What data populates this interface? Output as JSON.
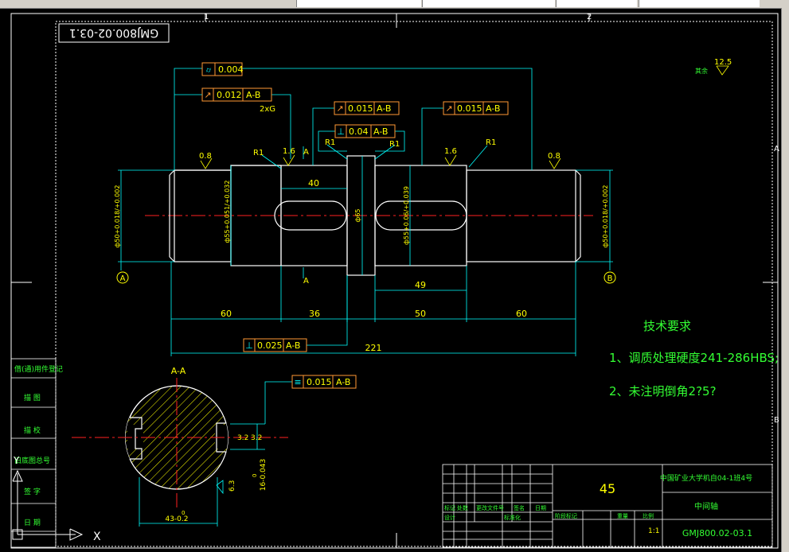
{
  "colors": {
    "background": "#000000",
    "outline": "#ffffff",
    "dimension": "#00ffff",
    "tolerance_frame": "#ff9933",
    "centerline": "#ff2020",
    "text": "#ffff00",
    "green_text": "#33ff33"
  },
  "drawing_number_rotated": "GMJ800.02-03.1",
  "grid_labels": {
    "top1": "1",
    "top2": "2",
    "right1": "A",
    "right2": "B"
  },
  "tolerances": {
    "cylindricity": {
      "symbol": "⌭",
      "value": "0.004"
    },
    "runout_left": {
      "value": "0.012",
      "datum": "A-B"
    },
    "runout_mid1": {
      "value": "0.015",
      "datum": "A-B"
    },
    "runout_mid2": {
      "value": "0.015",
      "datum": "A-B"
    },
    "perp_shoulder": {
      "value": "0.04",
      "datum": "A-B"
    },
    "perp_bottom": {
      "value": "0.025",
      "datum": "A-B"
    },
    "symmetry": {
      "value": "0.015",
      "datum": "A-B"
    }
  },
  "notes": {
    "two_x_g": "2xG",
    "r1_left": "R1",
    "r1_right": "R1",
    "r1_a": "R1",
    "r1_b": "R1",
    "rough_08_left": "0.8",
    "rough_16_left": "1.6",
    "rough_16_right": "1.6",
    "rough_08_right": "0.8",
    "section_letter_top": "A",
    "section_letter_bottom": "A",
    "datum_a": "A",
    "datum_b": "B",
    "rest_roughness": "12.5",
    "rest_label": "其余"
  },
  "diameters": {
    "left": "ф50+0.018/+0.002",
    "left_key": "ф55+0.051/+0.032",
    "collar": "ф65",
    "right_key": "ф55+0.06/+0.039",
    "right": "ф50+0.018/+0.002"
  },
  "lengths": {
    "key_left": "40",
    "key_right": "49",
    "d60_left": "60",
    "d36": "36",
    "d50": "50",
    "d60_right": "60",
    "total": "221"
  },
  "section": {
    "title": "A-A",
    "width_dim": "43-0.2",
    "width_dim_upper": "0",
    "depth_dim": "16-0.043",
    "depth_dim_upper": "0",
    "rough_32a": "3.2",
    "rough_32b": "3.2",
    "rough_63": "6.3"
  },
  "tech": {
    "title": "技术要求",
    "line1": "1、调质处理硬度241-286HBS;",
    "line2": "2、未注明倒角2?5?"
  },
  "title_block": {
    "material": "45",
    "school": "中国矿业大学机自04-1班4号",
    "part_name": "中间轴",
    "drawing_no": "GMJ800.02-03.1",
    "scale_label": "比例",
    "scale_value": "1:1",
    "mark_label": "阶段标记",
    "weight_label": "重量",
    "headers": [
      "标记",
      "处数",
      "更改文件号",
      "签名",
      "日期"
    ],
    "roles": [
      "设计",
      "标准化"
    ],
    "left_strip": [
      "借(通)用件登记",
      "描 图",
      "描 校",
      "旧底图总号",
      "签 字",
      "日 期"
    ]
  },
  "ucs": {
    "x_label": "X",
    "y_label": "Y"
  }
}
